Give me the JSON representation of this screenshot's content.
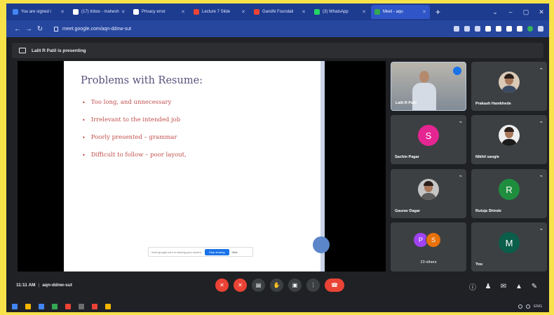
{
  "browser": {
    "tabs": [
      {
        "label": "You are signed i",
        "icon_color": "#4285f4"
      },
      {
        "label": "(17) Inbox - mahesh",
        "icon_color": "#ffffff"
      },
      {
        "label": "Privacy error",
        "icon_color": "#ffffff"
      },
      {
        "label": "Lecture 7 Slide",
        "icon_color": "#ea4335"
      },
      {
        "label": "Gandhi Foundati",
        "icon_color": "#ea4335"
      },
      {
        "label": "(3) WhatsApp",
        "icon_color": "#25d366"
      },
      {
        "label": "Meet - aqu",
        "icon_color": "#34a853"
      }
    ],
    "active_tab_index": 6,
    "new_tab_label": "+",
    "window_controls": [
      "⌄",
      "–",
      "▢",
      "✕"
    ],
    "url": "meet.google.com/aqn-ddnw-sut"
  },
  "meet": {
    "presenting_text": "Lalit R Patil is presenting",
    "slide": {
      "title": "Problems with Resume:",
      "bullet_glyph": "•",
      "bullets": [
        "Too long, and unnecessary",
        "Irrelevant to the intended job",
        "Poorly presented – grammar",
        "Difficult to follow – poor layout,"
      ]
    },
    "sharing_bar": {
      "text": "meet.google.com is sharing your screen.",
      "stop_label": "Stop sharing",
      "hide_label": "Hide"
    },
    "participants": {
      "self": {
        "name": "Lalit R Patil"
      },
      "p1": {
        "name": "Prakash Hamkhede"
      },
      "p2": {
        "name": "Sachin Pagar",
        "initial": "S",
        "color": "#e52592"
      },
      "p3": {
        "name": "Nikhil sangle"
      },
      "p4": {
        "name": "Gaurav Dagar"
      },
      "p5": {
        "name": "Rutuja Shinde",
        "initial": "R",
        "color": "#1e8e3e"
      },
      "others": {
        "label": "23 others",
        "initials": [
          "P",
          "S"
        ],
        "colors": [
          "#a142f4",
          "#e8710a"
        ]
      },
      "you": {
        "name": "You",
        "initial": "M",
        "color": "#0b5e4a"
      }
    },
    "mic_off_glyph": "⌁",
    "time": "11:11 AM",
    "meeting_code": "aqn-ddnw-sut",
    "meeting_sep": "|",
    "controls": [
      {
        "name": "mic-button",
        "glyph": "✕",
        "style": "red"
      },
      {
        "name": "camera-button",
        "glyph": "✕",
        "style": "red"
      },
      {
        "name": "captions-button",
        "glyph": "▤",
        "style": "grey"
      },
      {
        "name": "raise-hand-button",
        "glyph": "✋",
        "style": "grey"
      },
      {
        "name": "present-button",
        "glyph": "▣",
        "style": "grey"
      },
      {
        "name": "more-options-button",
        "glyph": "⋮",
        "style": "grey"
      }
    ],
    "end_call_glyph": "☎",
    "right_controls": [
      "ⓘ",
      "♟",
      "✉",
      "▲",
      "✎"
    ]
  },
  "taskbar": {
    "icon_colors": [
      "#4285f4",
      "#f4b400",
      "#4285f4",
      "#34a853",
      "#ea4335",
      "#6d6d6d",
      "#ea4335",
      "#f4b400"
    ],
    "tray_text": "ENG"
  }
}
